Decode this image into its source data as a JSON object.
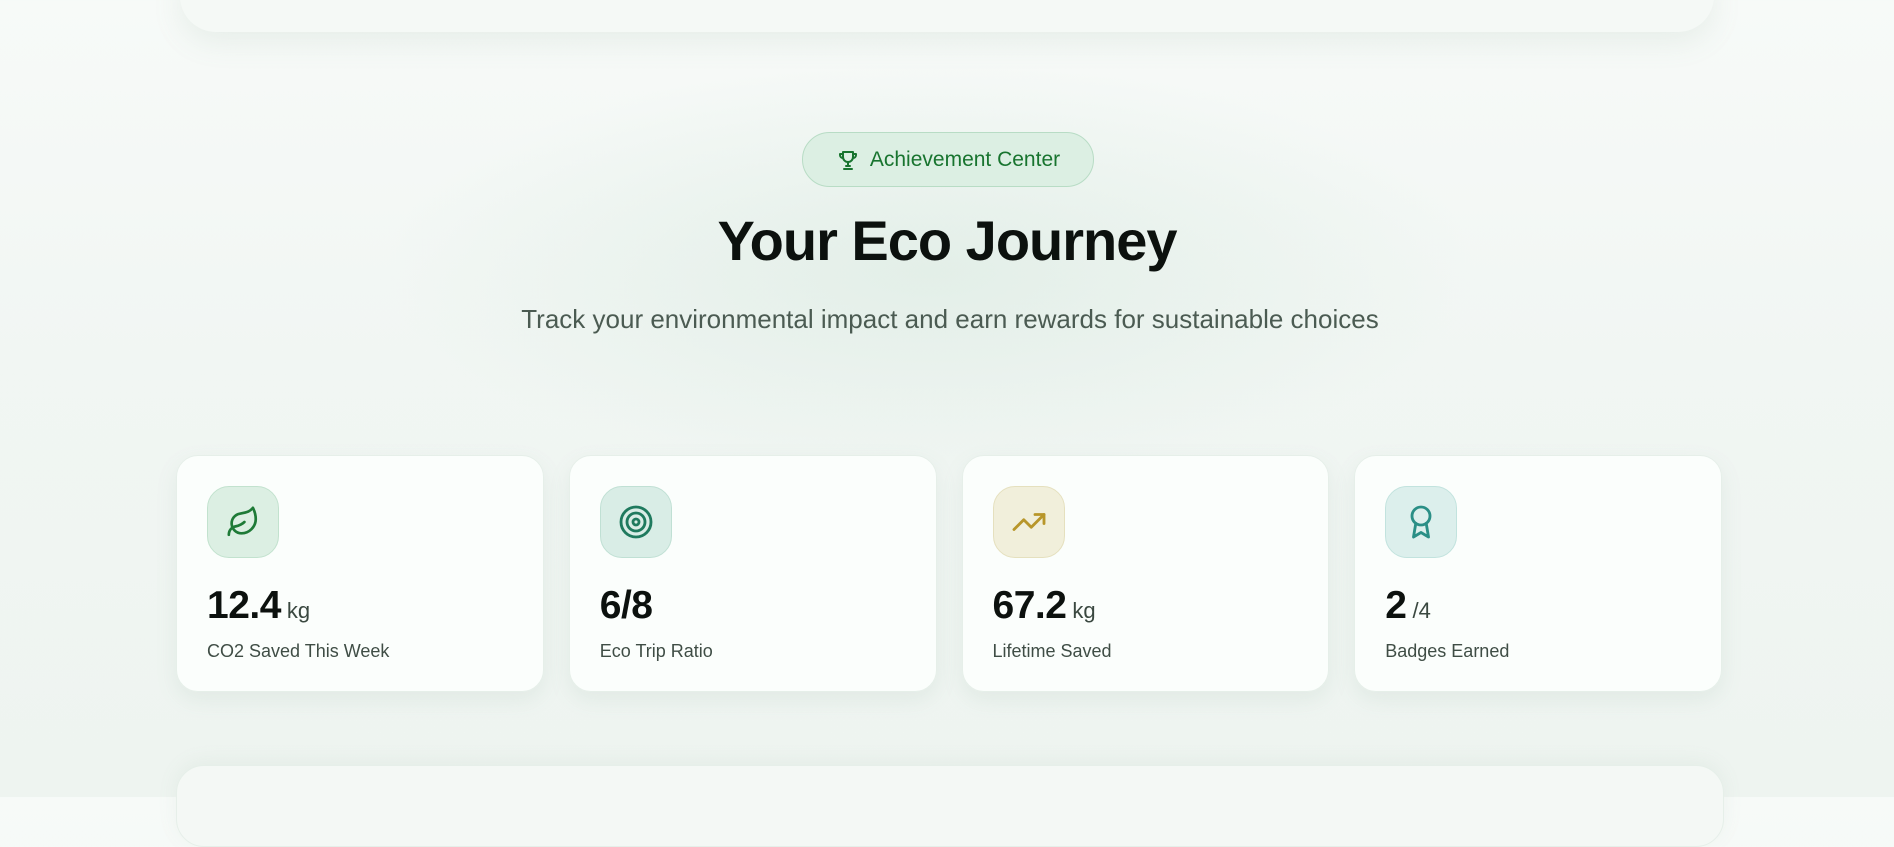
{
  "header": {
    "badge_label": "Achievement Center",
    "badge_icon": "trophy-icon",
    "title": "Your Eco Journey",
    "subtitle": "Track your environmental impact and earn rewards for sustainable choices"
  },
  "stats": [
    {
      "icon": "leaf-icon",
      "value": "12.4",
      "unit": "kg",
      "label": "CO2 Saved This Week",
      "color": "#1e7a37"
    },
    {
      "icon": "target-icon",
      "value": "6/8",
      "unit": "",
      "label": "Eco Trip Ratio",
      "color": "#1f7a5e"
    },
    {
      "icon": "trending-up-icon",
      "value": "67.2",
      "unit": "kg",
      "label": "Lifetime Saved",
      "color": "#b8962a"
    },
    {
      "icon": "award-icon",
      "value": "2",
      "unit": "/4",
      "label": "Badges Earned",
      "color": "#2a8f86"
    }
  ],
  "colors": {
    "accent_green": "#18742f",
    "badge_bg": "#dcefe3"
  }
}
